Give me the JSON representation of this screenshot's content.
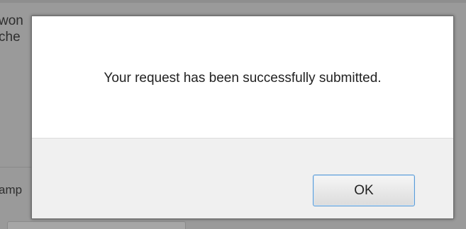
{
  "background": {
    "line1": "won",
    "line2": "che",
    "line3": "amp"
  },
  "dialog": {
    "message": "Your request has been successfully submitted.",
    "ok_label": "OK"
  },
  "colors": {
    "overlay": "#9a9a9a",
    "dialog_bg": "#ffffff",
    "footer_bg": "#f0f0f0",
    "button_border": "#5b9bd5"
  }
}
